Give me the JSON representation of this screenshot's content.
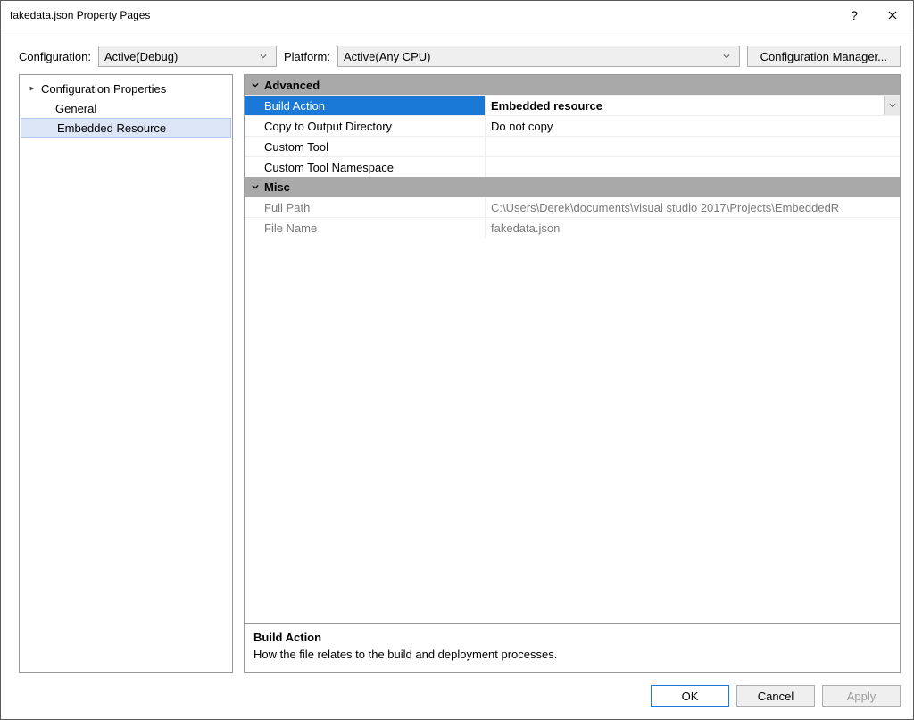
{
  "title": "fakedata.json Property Pages",
  "toolbar": {
    "configuration_label": "Configuration:",
    "configuration_value": "Active(Debug)",
    "platform_label": "Platform:",
    "platform_value": "Active(Any CPU)",
    "manager_button": "Configuration Manager..."
  },
  "tree": {
    "root": "Configuration Properties",
    "items": [
      "General",
      "Embedded Resource"
    ],
    "selected_index": 1
  },
  "categories": {
    "advanced": {
      "label": "Advanced",
      "rows": {
        "build_action": {
          "name": "Build Action",
          "value": "Embedded resource"
        },
        "copy_output": {
          "name": "Copy to Output Directory",
          "value": "Do not copy"
        },
        "custom_tool": {
          "name": "Custom Tool",
          "value": ""
        },
        "custom_tool_ns": {
          "name": "Custom Tool Namespace",
          "value": ""
        }
      }
    },
    "misc": {
      "label": "Misc",
      "rows": {
        "full_path": {
          "name": "Full Path",
          "value": "C:\\Users\\Derek\\documents\\visual studio 2017\\Projects\\EmbeddedR"
        },
        "file_name": {
          "name": "File Name",
          "value": "fakedata.json"
        }
      }
    }
  },
  "description": {
    "title": "Build Action",
    "text": "How the file relates to the build and deployment processes."
  },
  "footer": {
    "ok": "OK",
    "cancel": "Cancel",
    "apply": "Apply"
  }
}
